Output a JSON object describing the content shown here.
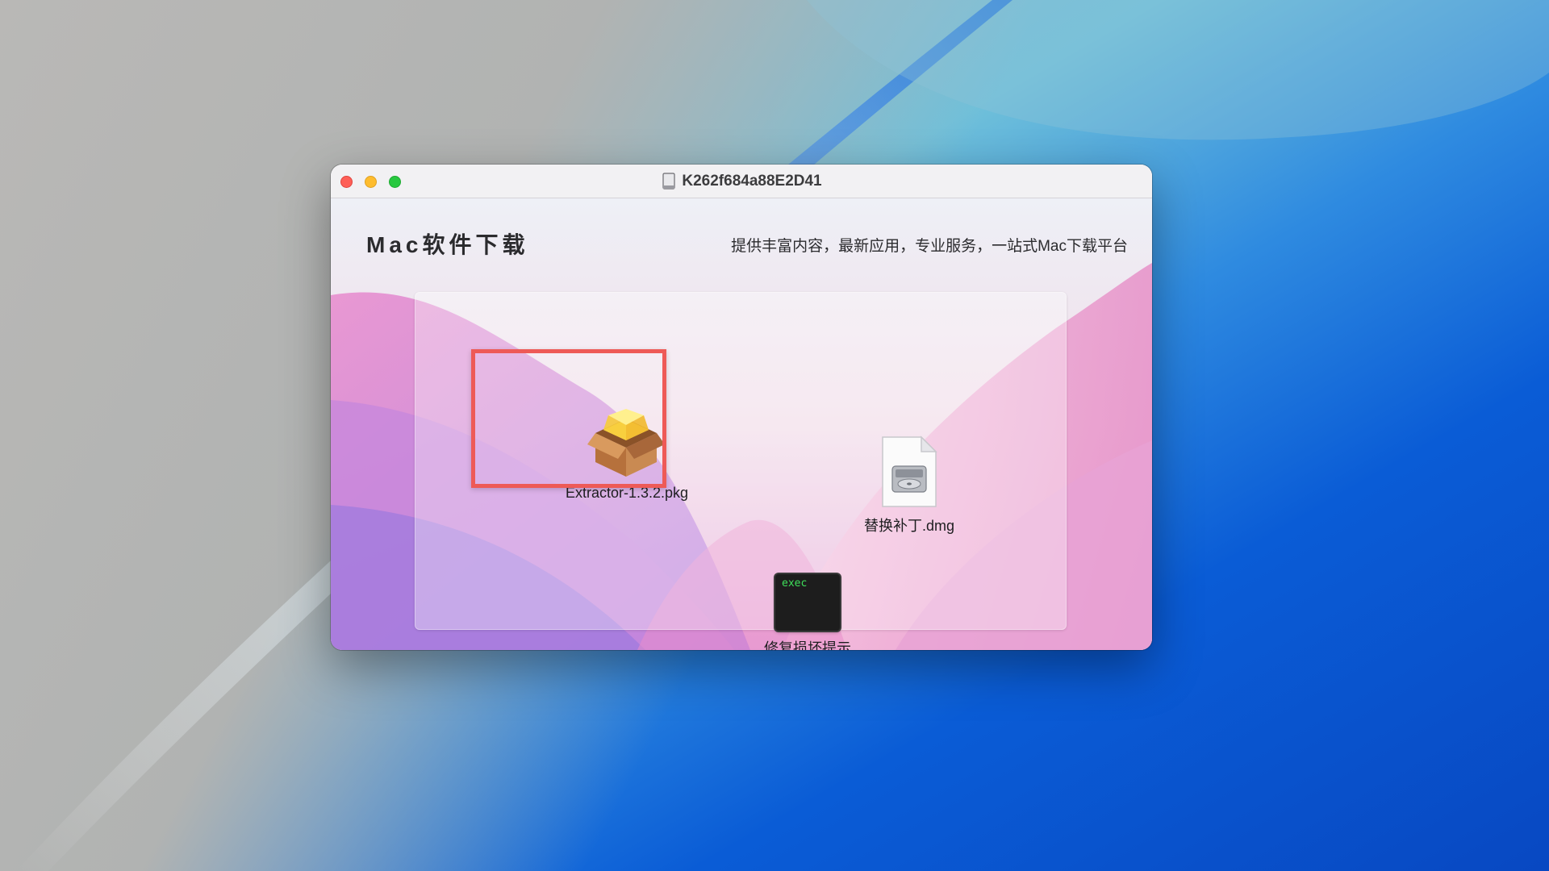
{
  "window": {
    "title": "K262f684a88E2D41",
    "buttons": {
      "close": "close",
      "minimize": "minimize",
      "zoom": "zoom"
    }
  },
  "header": {
    "brand": "Mac软件下载",
    "tagline": "提供丰富内容，最新应用，专业服务，一站式Mac下载平台"
  },
  "files": {
    "pkg": {
      "name": "Extractor-1.3.2.pkg",
      "icon": "package-icon",
      "highlighted": true
    },
    "dmg": {
      "name": "替换补丁.dmg",
      "icon": "disk-image-icon"
    },
    "exec": {
      "name": "修复损坏提示",
      "icon": "terminal-exec-icon",
      "icon_text": "exec"
    }
  },
  "colors": {
    "highlight": "#ee5a57",
    "close": "#fe5f57",
    "minimize": "#febc2e",
    "zoom": "#28c840",
    "terminal_text": "#3ee05a"
  }
}
